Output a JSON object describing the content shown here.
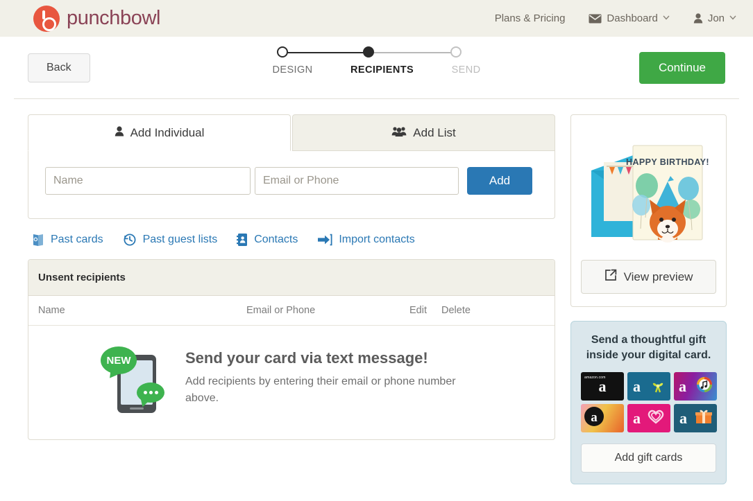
{
  "header": {
    "brand": "punchbowl",
    "brand_mark_icon": "punchbowl-logo-icon",
    "nav": [
      {
        "label": "Plans & Pricing",
        "icon": null,
        "caret": false
      },
      {
        "label": "Dashboard",
        "icon": "envelope-icon",
        "caret": true
      },
      {
        "label": "Jon",
        "icon": "person-icon",
        "caret": true
      }
    ],
    "caret_glyph": "⌄"
  },
  "wizard": {
    "back_label": "Back",
    "continue_label": "Continue",
    "steps": [
      {
        "label": "DESIGN",
        "state": "complete"
      },
      {
        "label": "RECIPIENTS",
        "state": "current"
      },
      {
        "label": "SEND",
        "state": "upcoming"
      }
    ]
  },
  "tabs": [
    {
      "label": "Add Individual",
      "icon": "person-icon",
      "active": true
    },
    {
      "label": "Add List",
      "icon": "group-icon",
      "active": false
    }
  ],
  "add_form": {
    "name_value": "",
    "name_placeholder": "Name",
    "contact_value": "",
    "contact_placeholder": "Email or Phone",
    "add_label": "Add"
  },
  "quick_links": [
    {
      "label": "Past cards",
      "icon": "card-icon"
    },
    {
      "label": "Past guest lists",
      "icon": "clock-history-icon"
    },
    {
      "label": "Contacts",
      "icon": "contact-book-icon"
    },
    {
      "label": "Import contacts",
      "icon": "import-arrow-icon"
    }
  ],
  "recipients": {
    "section_title": "Unsent recipients",
    "columns": [
      "Name",
      "Email or Phone",
      "Edit",
      "Delete"
    ],
    "rows": [],
    "empty_state": {
      "badge": "NEW",
      "icon": "phone-text-message-icon",
      "heading": "Send your card via text message!",
      "body": "Add recipients by entering their email or phone number above."
    }
  },
  "sidebar": {
    "preview": {
      "card_art_alt": "birthday-fox-card-icon",
      "card_greeting": "HAPPY BIRTHDAY!",
      "button_label": "View preview",
      "button_icon": "external-link-icon"
    },
    "gift": {
      "title": "Send a thoughtful gift inside your digital card.",
      "button_label": "Add gift cards",
      "cards": [
        {
          "name": "amazon-gift-card-black",
          "brand": "a",
          "sub": "amazon.com"
        },
        {
          "name": "amazon-gift-card-bow",
          "brand": "a",
          "sub": ""
        },
        {
          "name": "amazon-gift-card-music",
          "brand": "a",
          "sub": ""
        },
        {
          "name": "amazon-gift-card-floral",
          "brand": "a",
          "sub": ""
        },
        {
          "name": "amazon-gift-card-heart",
          "brand": "a",
          "sub": ""
        },
        {
          "name": "amazon-gift-card-present",
          "brand": "a",
          "sub": ""
        }
      ]
    }
  },
  "colors": {
    "brand_red": "#e8563f",
    "brand_wordmark": "#8a4356",
    "header_bg": "#f1f0e8",
    "continue_green": "#3fa845",
    "add_blue": "#2a78b4",
    "link_blue": "#2a78b4",
    "gift_panel_bg": "#dbe7ec",
    "badge_green": "#3eb34f"
  }
}
